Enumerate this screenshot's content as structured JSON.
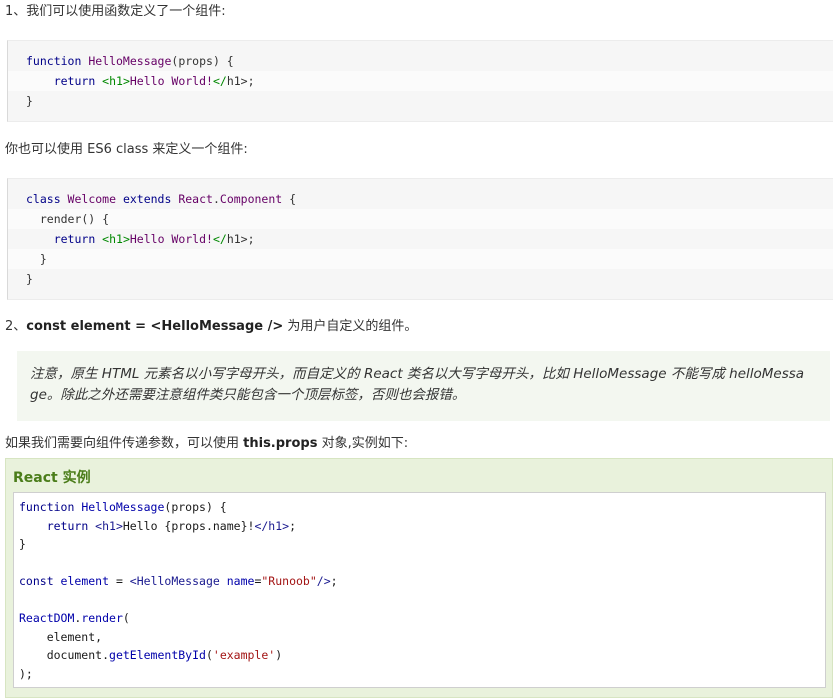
{
  "section1": {
    "intro": "1、我们可以使用函数定义了一个组件:",
    "code": [
      [
        [
          "kw",
          "function "
        ],
        [
          "fn",
          "HelloMessage"
        ],
        [
          "pl",
          "(props) {"
        ]
      ],
      [
        [
          "pl",
          "    "
        ],
        [
          "kw",
          "return "
        ],
        [
          "tag",
          "<h1>"
        ],
        [
          "fn",
          "Hello World!"
        ],
        [
          "tag",
          "</"
        ],
        [
          "pl",
          "h1>;"
        ]
      ],
      [
        [
          "pl",
          "}"
        ]
      ]
    ],
    "es6_text": "你也可以使用 ES6 class 来定义一个组件:",
    "code2": [
      [
        [
          "kw",
          "class "
        ],
        [
          "fn",
          "Welcome "
        ],
        [
          "kw",
          "extends "
        ],
        [
          "fn",
          "React"
        ],
        [
          "pl",
          "."
        ],
        [
          "fn",
          "Component "
        ],
        [
          "pl",
          "{"
        ]
      ],
      [
        [
          "pl",
          "  render() {"
        ]
      ],
      [
        [
          "pl",
          "    "
        ],
        [
          "kw",
          "return "
        ],
        [
          "tag",
          "<h1>"
        ],
        [
          "fn",
          "Hello World!"
        ],
        [
          "tag",
          "</"
        ],
        [
          "pl",
          "h1>;"
        ]
      ],
      [
        [
          "pl",
          "  }"
        ]
      ],
      [
        [
          "pl",
          "}"
        ]
      ]
    ]
  },
  "section2": {
    "prefix": "2、",
    "bold": "const element = <HelloMessage />",
    "suffix": " 为用户自定义的组件。",
    "note_line1": "注意，原生 HTML 元素名以小写字母开头，而自定义的 React 类名以大写字母开头，比如 HelloMessage 不能写成 helloMessa",
    "note_line2": "ge。除此之外还需要注意组件类只能包含一个顶层标签，否则也会报错。"
  },
  "props_text": {
    "prefix": "如果我们需要向组件传递参数，可以使用 ",
    "bold": "this.props",
    "suffix": " 对象,实例如下:"
  },
  "example": {
    "title": "React 实例",
    "code": [
      [
        [
          "ex-kw",
          "function "
        ],
        [
          "ex-fn",
          "HelloMessage"
        ],
        [
          "ex-pl",
          "(props) {"
        ]
      ],
      [
        [
          "ex-pl",
          "    "
        ],
        [
          "ex-kw",
          "return "
        ],
        [
          "ex-tag",
          "<h1>"
        ],
        [
          "ex-pl",
          "Hello {props.name}!"
        ],
        [
          "ex-tag",
          "</h1>"
        ],
        [
          "ex-pl",
          ";"
        ]
      ],
      [
        [
          "ex-pl",
          "}"
        ]
      ],
      [
        [
          "ex-pl",
          ""
        ]
      ],
      [
        [
          "ex-kw",
          "const "
        ],
        [
          "ex-fn",
          "element "
        ],
        [
          "ex-pl",
          "= "
        ],
        [
          "ex-tag",
          "<HelloMessage "
        ],
        [
          "ex-fn",
          "name"
        ],
        [
          "ex-pl",
          "="
        ],
        [
          "ex-str",
          "\"Runoob\""
        ],
        [
          "ex-tag",
          "/>"
        ],
        [
          "ex-pl",
          ";"
        ]
      ],
      [
        [
          "ex-pl",
          ""
        ]
      ],
      [
        [
          "ex-fn",
          "ReactDOM"
        ],
        [
          "ex-pl",
          "."
        ],
        [
          "ex-fn",
          "render"
        ],
        [
          "ex-pl",
          "("
        ]
      ],
      [
        [
          "ex-pl",
          "    element,"
        ]
      ],
      [
        [
          "ex-pl",
          "    document."
        ],
        [
          "ex-fn",
          "getElementById"
        ],
        [
          "ex-pl",
          "("
        ],
        [
          "ex-str",
          "'example'"
        ],
        [
          "ex-pl",
          ")"
        ]
      ],
      [
        [
          "ex-pl",
          ");"
        ]
      ]
    ]
  }
}
